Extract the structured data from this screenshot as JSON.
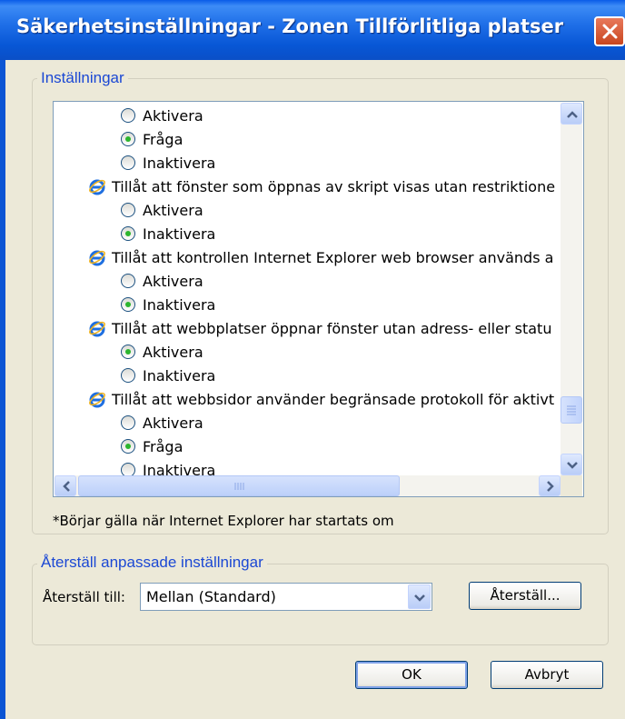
{
  "window": {
    "title": "Säkerhetsinställningar - Zonen Tillförlitliga platser"
  },
  "settings_group": {
    "legend": "Inställningar",
    "rows": [
      {
        "kind": "option",
        "label": "Aktivera",
        "selected": false
      },
      {
        "kind": "option",
        "label": "Fråga",
        "selected": true
      },
      {
        "kind": "option",
        "label": "Inaktivera",
        "selected": false
      },
      {
        "kind": "header",
        "label": "Tillåt att fönster som öppnas av skript visas utan restriktione",
        "icon": "ie-icon"
      },
      {
        "kind": "option",
        "label": "Aktivera",
        "selected": false
      },
      {
        "kind": "option",
        "label": "Inaktivera",
        "selected": true
      },
      {
        "kind": "header",
        "label": "Tillåt att kontrollen Internet Explorer web browser används a",
        "icon": "ie-icon"
      },
      {
        "kind": "option",
        "label": "Aktivera",
        "selected": false
      },
      {
        "kind": "option",
        "label": "Inaktivera",
        "selected": true
      },
      {
        "kind": "header",
        "label": "Tillåt att webbplatser öppnar fönster utan adress- eller statu",
        "icon": "ie-icon"
      },
      {
        "kind": "option",
        "label": "Aktivera",
        "selected": true
      },
      {
        "kind": "option",
        "label": "Inaktivera",
        "selected": false
      },
      {
        "kind": "header",
        "label": "Tillåt att webbsidor använder begränsade protokoll för aktivt",
        "icon": "ie-icon"
      },
      {
        "kind": "option",
        "label": "Aktivera",
        "selected": false
      },
      {
        "kind": "option",
        "label": "Fråga",
        "selected": true
      },
      {
        "kind": "option",
        "label": "Inaktivera",
        "selected": false
      }
    ],
    "note": "*Börjar gälla när Internet Explorer har startats om"
  },
  "reset_group": {
    "legend": "Återställ anpassade inställningar",
    "reset_to_label": "Återställ till:",
    "selected_level": "Mellan (Standard)",
    "reset_button": "Återställ..."
  },
  "footer": {
    "ok": "OK",
    "cancel": "Avbryt"
  },
  "colors": {
    "titlebar": "#0a5ce8",
    "dialog_bg": "#ece9d8",
    "legend_text": "#1b48d4",
    "radio_dot": "#2cb52f",
    "close_button": "#c9461e"
  }
}
